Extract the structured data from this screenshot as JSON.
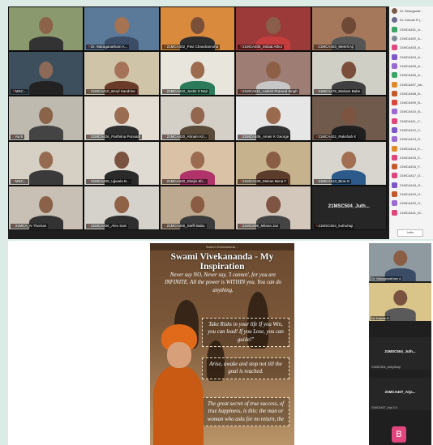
{
  "grid": {
    "tiles": [
      {
        "name": "",
        "bg": "#8a9a6e",
        "skin": "#8c6248",
        "shirt": "#333",
        "text_only": false
      },
      {
        "name": "Dr. Maraganatham A...",
        "bg": "#5b7a9a",
        "skin": "#a57352",
        "shirt": "#3a4c66",
        "text_only": false
      },
      {
        "name": "21MCA402_Pavi Chandramoha",
        "bg": "#d98a3c",
        "skin": "#7a5038",
        "shirt": "#2d2d2d",
        "text_only": false
      },
      {
        "name": "21MCA405_Mobat Athul",
        "bg": "#9c3a3a",
        "skin": "#8a5e4a",
        "shirt": "#c43c3c",
        "text_only": false
      },
      {
        "name": "21MCA403_Meerit Aji",
        "bg": "#a6785b",
        "skin": "#6e4a36",
        "shirt": "#555",
        "text_only": false
      },
      {
        "name": "MSC...",
        "bg": "#3d4e5c",
        "skin": "#8d6a58",
        "shirt": "#222",
        "text_only": false
      },
      {
        "name": "21MCA410_Beryl Sandrine",
        "bg": "#cfc4a8",
        "skin": "#a6735a",
        "shirt": "#6b3b2a",
        "text_only": false
      },
      {
        "name": "21MCA410_Justin S Nair",
        "bg": "#e8e6dc",
        "skin": "#9c6b4e",
        "shirt": "#2b7a5a",
        "text_only": false
      },
      {
        "name": "21MCA411_Ashish Pramod Singh",
        "bg": "#9e7d74",
        "skin": "#8c5f46",
        "shirt": "#c7c7c7",
        "text_only": false
      },
      {
        "name": "21MCA476_Mariam Babe",
        "bg": "#cfcfc6",
        "skin": "#7a4e3a",
        "shirt": "#404040",
        "text_only": false
      },
      {
        "name": "Aa 5",
        "bg": "#bfbab0",
        "skin": "#8a6448",
        "shirt": "#444",
        "text_only": false
      },
      {
        "name": "21MCA426_Parthima Ponnath",
        "bg": "#e3ddd3",
        "skin": "#9a6d52",
        "shirt": "#2f2f2f",
        "text_only": false
      },
      {
        "name": "21MCA420_Ahnam Kri...",
        "bg": "#d4cfc7",
        "skin": "#936650",
        "shirt": "#5a4a3a",
        "text_only": false
      },
      {
        "name": "21MCA406_Ameir K George",
        "bg": "#e6e6e6",
        "skin": "#9a6a4e",
        "shirt": "#333",
        "text_only": false
      },
      {
        "name": "21MCA402_Rakshah K",
        "bg": "#6f5a4b",
        "skin": "#7d5440",
        "shirt": "#1f1f1f",
        "text_only": false
      },
      {
        "name": "MSC...",
        "bg": "#d6cfc3",
        "skin": "#956a50",
        "shirt": "#3a3a3a",
        "text_only": false
      },
      {
        "name": "21MCA408_Ujjwala B...",
        "bg": "#e0dbd2",
        "skin": "#7a5240",
        "shirt": "#2a2a2a",
        "text_only": false
      },
      {
        "name": "21MCA420_Shejin Sh...",
        "bg": "#d9c2a5",
        "skin": "#9a6b50",
        "shirt": "#b0336a",
        "text_only": false
      },
      {
        "name": "21MCA109_Mekan Bena T",
        "bg": "#c7b28e",
        "skin": "#8a5e44",
        "shirt": "#5c3c2a",
        "text_only": false
      },
      {
        "name": "21MCA413_Bina G",
        "bg": "#d8d5ce",
        "skin": "#a26f52",
        "shirt": "#2c5a8a",
        "text_only": false
      },
      {
        "name": "21MCA_N Thomas",
        "bg": "#c9c0b5",
        "skin": "#8a624a",
        "shirt": "#333",
        "text_only": false
      },
      {
        "name": "21MCA406_Alex Sani",
        "bg": "#d5d2cc",
        "skin": "#8f6246",
        "shirt": "#2e2e2e",
        "text_only": false
      },
      {
        "name": "21MCA406_Steffi Babu",
        "bg": "#bda98f",
        "skin": "#8a5c44",
        "shirt": "#3b3b3b",
        "text_only": false
      },
      {
        "name": "21MCS08_Milana Jan",
        "bg": "#d2c7ba",
        "skin": "#7e5442",
        "shirt": "#444",
        "text_only": false
      },
      {
        "name": "21MSC504_kuthuhaji",
        "text": "21MSC504_Juth...",
        "text_only": true
      }
    ]
  },
  "participants": {
    "items": [
      {
        "label": "Dr. Maruganat...",
        "color": "#7a5c48",
        "photo": true
      },
      {
        "label": "Dr. Kumari R (...",
        "color": "#6a6a8a",
        "photo": true
      },
      {
        "label": "21MCA401_A...",
        "color": "#3aa565"
      },
      {
        "label": "21MCA402_A...",
        "color": "#7b8a96",
        "photo": true
      },
      {
        "label": "21MCA403_A...",
        "color": "#e0457b"
      },
      {
        "label": "21MCA404_A...",
        "color": "#7b57c9"
      },
      {
        "label": "21MCA405_A...",
        "color": "#9b6bd1"
      },
      {
        "label": "21MCA406_A...",
        "color": "#3aa565"
      },
      {
        "label": "21MCA407_Ab...",
        "color": "#e08a2c"
      },
      {
        "label": "21MCA408_B...",
        "color": "#c45a2a"
      },
      {
        "label": "21MCA409_B...",
        "color": "#d9453a"
      },
      {
        "label": "21MCA410_B...",
        "color": "#9b6bd1"
      },
      {
        "label": "21MCA411_C...",
        "color": "#e0457b"
      },
      {
        "label": "21MCA412_C...",
        "color": "#7b57c9"
      },
      {
        "label": "21MCA413_D...",
        "color": "#9b6bd1"
      },
      {
        "label": "21MCA414_E...",
        "color": "#e08a2c"
      },
      {
        "label": "21MCA415_E...",
        "color": "#e0457b"
      },
      {
        "label": "21MCA416_F...",
        "color": "#c45a2a"
      },
      {
        "label": "21MCA417_G...",
        "color": "#e0457b"
      },
      {
        "label": "21MCA418_G...",
        "color": "#7b57c9"
      },
      {
        "label": "21MCA419_H...",
        "color": "#c45a2a"
      },
      {
        "label": "21MCA420_H...",
        "color": "#9b6bd1"
      },
      {
        "label": "21MCA421_M...",
        "color": "#e0457b"
      }
    ],
    "footer_label": "Invite"
  },
  "poster": {
    "top_strip": "Swami Vivekananda ...",
    "title": "Swami Vivekananda - My Inspiration",
    "quote_1": "Never say NO, Never say, 'I cannot', for you are INFINITE. All the power is WITHIN you. You can do anything.",
    "quote_2": "Take Risks in your life If you Win, you can lead! If you Lose, you can guide!\"",
    "quote_3": "Arise, awake and stop not till the goal is reached.",
    "quote_4": "The great secret of true success, of true happiness, is this: the man or woman who asks for no return, the"
  },
  "side_panel": {
    "video_1_name": "Dr. Maruganatham A",
    "video_2_name": "Dr. Kumar R",
    "tile_1_text": "21MSC504_Juth...",
    "tile_1_name": "21MSC504_JuthyShaji",
    "tile_2_text": "21MCA407_Arja...",
    "tile_2_name": "21MCA407_Arja 2.6",
    "avatar_letter": "B"
  }
}
